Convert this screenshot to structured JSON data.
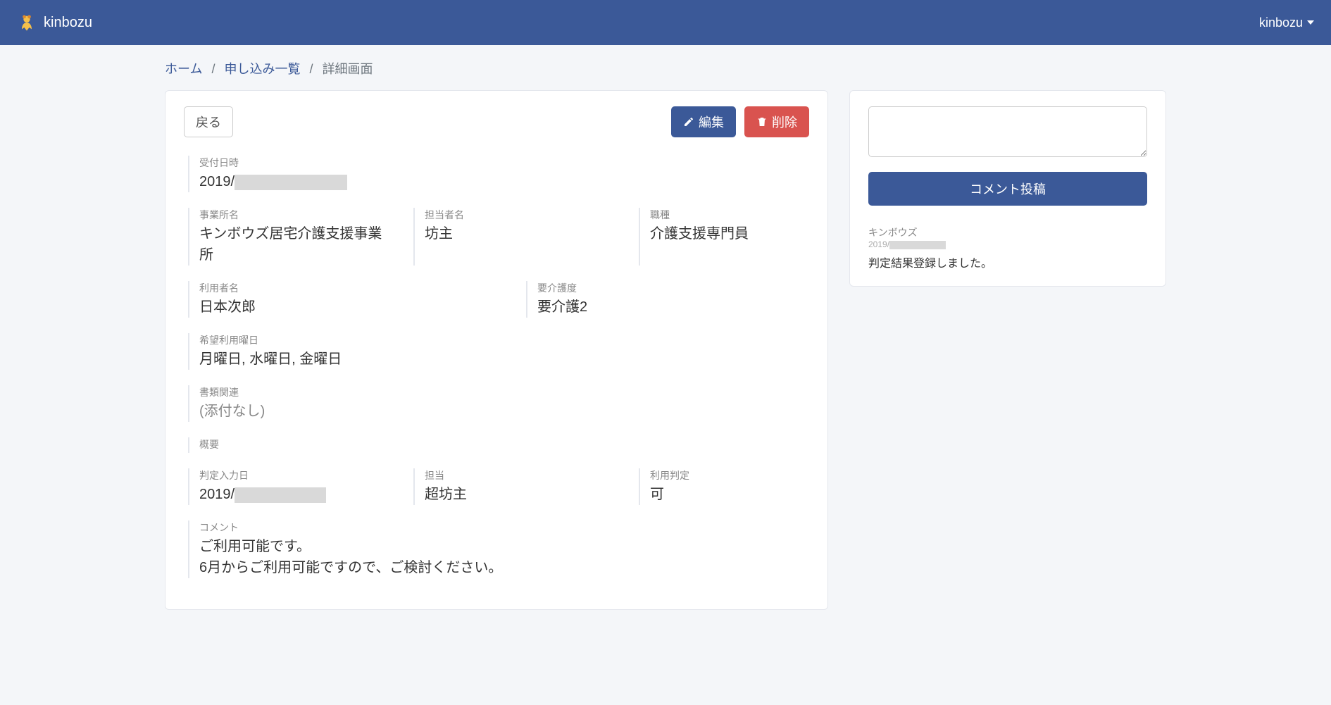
{
  "navbar": {
    "brand": "kinbozu",
    "user": "kinbozu"
  },
  "breadcrumb": {
    "home": "ホーム",
    "list": "申し込み一覧",
    "current": "詳細画面"
  },
  "toolbar": {
    "back": "戻る",
    "edit": "編集",
    "delete": "削除"
  },
  "detail": {
    "received_label": "受付日時",
    "received_prefix": "2019/",
    "office_label": "事業所名",
    "office_value": "キンボウズ居宅介護支援事業所",
    "contact_label": "担当者名",
    "contact_value": "坊主",
    "jobtype_label": "職種",
    "jobtype_value": "介護支援専門員",
    "user_label": "利用者名",
    "user_value": "日本次郎",
    "carelevel_label": "要介護度",
    "carelevel_value": "要介護2",
    "days_label": "希望利用曜日",
    "days_value": "月曜日, 水曜日, 金曜日",
    "docs_label": "書類関連",
    "docs_value": "(添付なし)",
    "summary_label": "概要",
    "summary_value": "",
    "judged_date_label": "判定入力日",
    "judged_date_prefix": "2019/",
    "judged_by_label": "担当",
    "judged_by_value": "超坊主",
    "judgement_label": "利用判定",
    "judgement_value": "可",
    "comment_label": "コメント",
    "comment_line1": "ご利用可能です。",
    "comment_line2": "6月からご利用可能ですので、ご検討ください。"
  },
  "side": {
    "submit": "コメント投稿",
    "comment": {
      "author": "キンボウズ",
      "date_prefix": "2019/",
      "body": "判定結果登録しました。"
    }
  }
}
